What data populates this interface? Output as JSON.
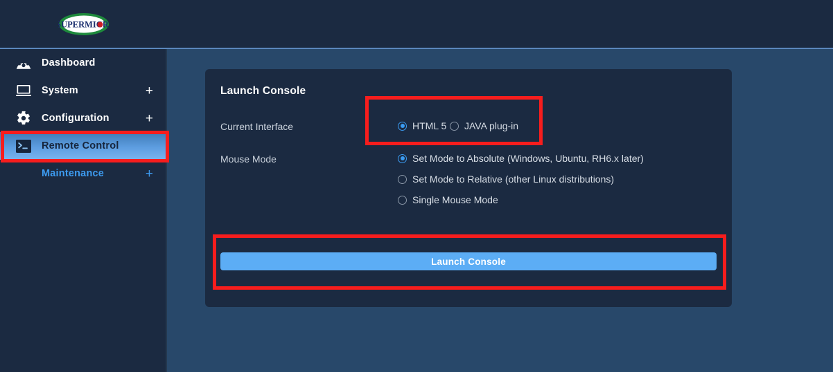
{
  "header": {
    "logo_alt": "SUPERMICRO",
    "logo_text": "SUPERMICR"
  },
  "sidebar": {
    "items": [
      {
        "label": "Dashboard",
        "icon": "gauge-icon",
        "expandable": false,
        "plus": "",
        "active": false,
        "sub": false
      },
      {
        "label": "System",
        "icon": "monitor-icon",
        "expandable": true,
        "plus": "+",
        "active": false,
        "sub": false
      },
      {
        "label": "Configuration",
        "icon": "gear-icon",
        "expandable": true,
        "plus": "+",
        "active": false,
        "sub": false
      },
      {
        "label": "Remote Control",
        "icon": "terminal-icon",
        "expandable": false,
        "plus": "",
        "active": true,
        "sub": false
      },
      {
        "label": "Maintenance",
        "icon": "none",
        "expandable": true,
        "plus": "+",
        "active": false,
        "sub": true
      }
    ]
  },
  "card": {
    "title": "Launch Console",
    "current_interface": {
      "label": "Current Interface",
      "options": [
        {
          "label": "HTML 5",
          "checked": true
        },
        {
          "label": "JAVA plug-in",
          "checked": false
        }
      ]
    },
    "mouse_mode": {
      "label": "Mouse Mode",
      "options": [
        {
          "label": "Set Mode to Absolute (Windows, Ubuntu, RH6.x later)",
          "checked": true
        },
        {
          "label": "Set Mode to Relative (other Linux distributions)",
          "checked": false
        },
        {
          "label": "Single Mouse Mode",
          "checked": false
        }
      ]
    },
    "launch_button": "Launch Console"
  },
  "colors": {
    "panel_dark": "#1b2a41",
    "content_bg": "#28486a",
    "accent_blue": "#5cadf5",
    "link_blue": "#3d9bf0",
    "annotation_red": "#f71d1d"
  }
}
